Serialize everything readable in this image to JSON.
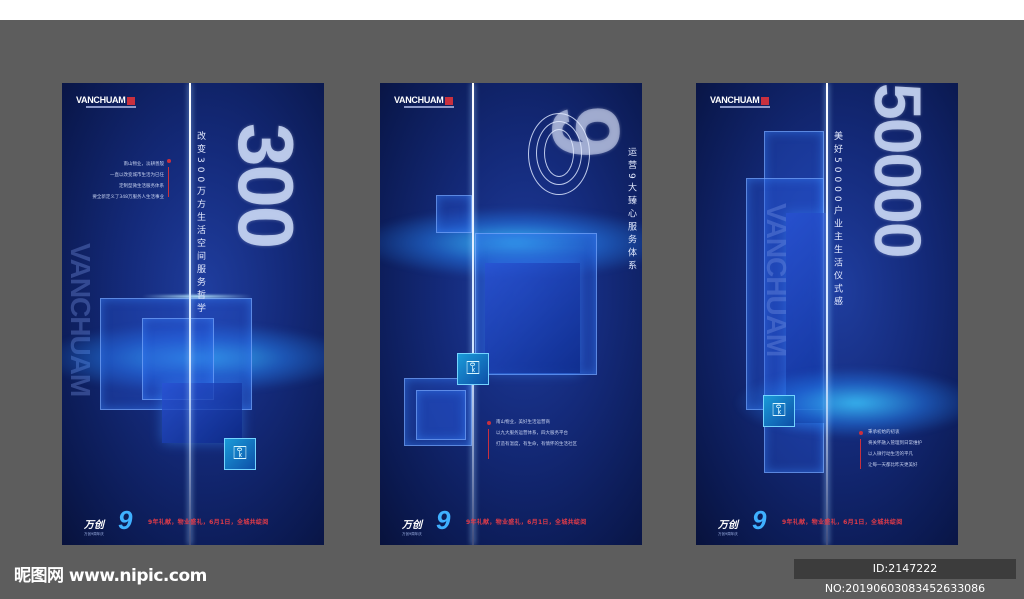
{
  "watermark": {
    "site": "昵图网 www.nipic.com",
    "id": "ID:2147222 NO:20190603083452633086"
  },
  "brand": {
    "logo": "VANCHUAM",
    "footer_logo": "万创",
    "footer_nine": "9",
    "footer_sub": "万创9周年庆"
  },
  "footer_slogan": "9年礼献，物业盛礼，6月1日，全城共绽阅",
  "ghost_text": "VANCHUAM",
  "posters": [
    {
      "big_number": "300",
      "vertical_title": "改变300万方生活空间服务哲学",
      "body": [
        "南山物业，淡耕善殷",
        "一直以改变城市生活为已任",
        "定制型微生活服务体系",
        "要全新定义了348万服务人生活事业"
      ]
    },
    {
      "big_number": "9",
      "vertical_title": "运营9大臻心服务体系",
      "body": [
        "南山物业，美好生活运营商",
        "以九大服务运营体系，四大服务平台",
        "打造有温度，有生命，有情怀的生活社区"
      ]
    },
    {
      "big_number": "50000",
      "vertical_title": "美好50000户业主生活仪式感",
      "body": [
        "秉承初始的初衷",
        "将关怀融入管理到日常维护",
        "以入微行动生活的平凡",
        "让每一天都比昨天更美好"
      ]
    }
  ],
  "colors": {
    "frame_bg": "#5d5d5d",
    "poster_blue": "#142a7a",
    "accent_red": "#e23b48",
    "glow_cyan": "#3fb0ff"
  }
}
